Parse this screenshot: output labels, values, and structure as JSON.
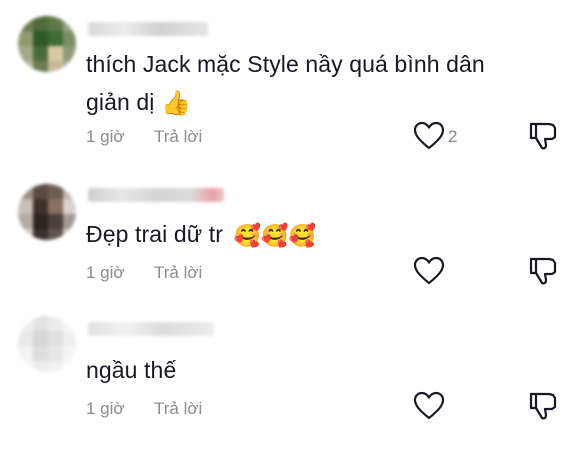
{
  "comments": [
    {
      "text_line1": "thích Jack mặc Style nầy quá bình dân",
      "text_line2": "giản dị",
      "emoji": "👍",
      "time": "1 giờ",
      "reply_label": "Trả lời",
      "like_count": "2"
    },
    {
      "text": "Đẹp trai dữ tr",
      "emojis": "🥰🥰🥰",
      "time": "1 giờ",
      "reply_label": "Trả lời"
    },
    {
      "text": "ngầu thế",
      "time": "1 giờ",
      "reply_label": "Trả lời"
    }
  ],
  "icons": {
    "like": "heart-outline-icon",
    "dislike": "thumbs-down-icon"
  },
  "colors": {
    "text": "#161823",
    "meta": "#8a8b91"
  }
}
